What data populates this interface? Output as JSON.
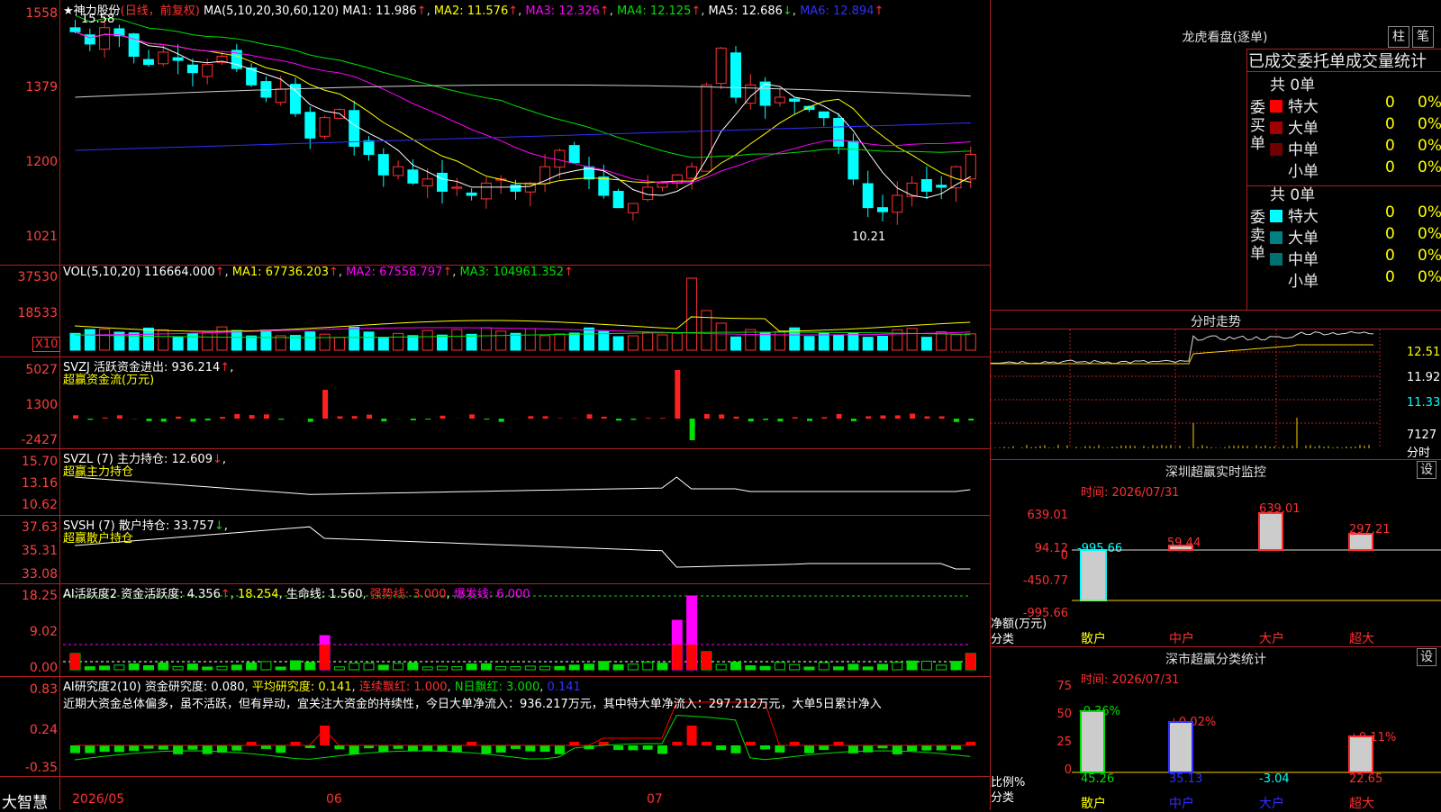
{
  "main": {
    "title_star": "★",
    "stock_name": "神力股份",
    "period": "(日线，前复权)",
    "ma_label": "MA(5,10,20,30,60,120)",
    "ma1": "MA1: 11.986",
    "ma2": "MA2: 11.576",
    "ma3": "MA3: 12.326",
    "ma4": "MA4: 12.125",
    "ma5": "MA5: 12.686",
    "ma6": "MA6: 12.894",
    "arr_up": "↑",
    "arr_down": "↓",
    "max_label": "15.58",
    "min_label": "10.21",
    "y_ticks": [
      "1558",
      "1379",
      "1200",
      "1021"
    ]
  },
  "vol": {
    "label": "VOL(5,10,20)",
    "value": "116664.000",
    "ma1": "MA1: 67736.203",
    "ma2": "MA2: 67558.797",
    "ma3": "MA3: 104961.352",
    "y_ticks": [
      "37530",
      "18533"
    ],
    "multiplier": "X10"
  },
  "svzj": {
    "label": "SVZJ  活跃资金进出: 936.214",
    "sub": "超赢资金流(万元)",
    "y_ticks": [
      "5027",
      "1300",
      "-2427"
    ]
  },
  "svzl": {
    "label": "SVZL (7) 主力持仓: 12.609",
    "sub": "超赢主力持仓",
    "y_ticks": [
      "15.70",
      "13.16",
      "10.62"
    ]
  },
  "svsh": {
    "label": "SVSH (7) 散户持仓: 33.757",
    "sub": "超赢散户持仓",
    "y_ticks": [
      "37.63",
      "35.31",
      "33.08"
    ]
  },
  "ai1": {
    "label": "AI活跃度2 资金活跃度: 4.356",
    "v2": "18.254",
    "life": "生命线: 1.560",
    "strong": "强势线: 3.000",
    "burst": "爆发线: 6.000",
    "y_ticks": [
      "18.25",
      "9.02",
      "0.00"
    ]
  },
  "ai2": {
    "label": "AI研究度2(10) 资金研究度: 0.080",
    "avg": "平均研究度: 0.141",
    "lian": "连续飘红: 1.000",
    "nday": "N日飘红: 3.000",
    "v5": "0.141",
    "text": "近期大资金总体偏多，虽不活跃，但有异动，宜关注大资金的持续性，今日大单净流入：936.217万元，其中特大单净流入：297.212万元，大单5日累计净入",
    "y_ticks": [
      "0.83",
      "0.24",
      "-0.35"
    ]
  },
  "bottom": {
    "brand": "大智慧",
    "d1": "2026/05",
    "d2": "06",
    "d3": "07"
  },
  "right": {
    "lhkp_title": "龙虎看盘(逐单)",
    "btn_zhu": "柱",
    "btn_bi": "笔",
    "table_title": "已成交委托单成交量统计",
    "buy_total": "共 0单",
    "sell_total": "共 0单",
    "buy_label": "委买单",
    "sell_label": "委卖单",
    "rows": [
      {
        "name": "特大",
        "v": "0",
        "p": "0%"
      },
      {
        "name": "大单",
        "v": "0",
        "p": "0%"
      },
      {
        "name": "中单",
        "v": "0",
        "p": "0%"
      },
      {
        "name": "小单",
        "v": "0",
        "p": "0%"
      }
    ],
    "fenshi_title": "分时走势",
    "fs_ticks": [
      "12.51",
      "11.92",
      "11.33",
      "7127",
      "分时"
    ],
    "sz_title": "深圳超赢实时监控",
    "sz_time": "时间: 2026/07/31",
    "sz_btn": "设",
    "sz_ticks": [
      "639.01",
      "94.12",
      "0",
      "-450.77",
      "-995.66"
    ],
    "sz_vals": [
      "-995.66",
      "59.44",
      "639.01",
      "297.21"
    ],
    "sz_ylabel": "净额(万元)",
    "sz_xlabel": "分类",
    "cats": [
      "散户",
      "中户",
      "大户",
      "超大"
    ],
    "sc_title": "深市超赢分类统计",
    "sc_time": "时间: 2026/07/31",
    "sc_btn": "设",
    "sc_ticks": [
      "75",
      "50",
      "25",
      "0"
    ],
    "sc_top": [
      "-0.36%",
      "+0.02%",
      "+0.11%"
    ],
    "sc_bottom": [
      "45.26",
      "35.13",
      "-3.04",
      "22.65"
    ],
    "sc_ylabel": "比例%",
    "sc_xlabel": "分类"
  },
  "colors": {
    "up": "#ff3232",
    "down": "#00ffff",
    "grid": "#b02020",
    "ma1": "#ffffff",
    "ma2": "#ffff00",
    "ma3": "#ff00ff",
    "ma4": "#00e000",
    "ma5": "#d0d0d0",
    "ma6": "#3030ff"
  }
}
